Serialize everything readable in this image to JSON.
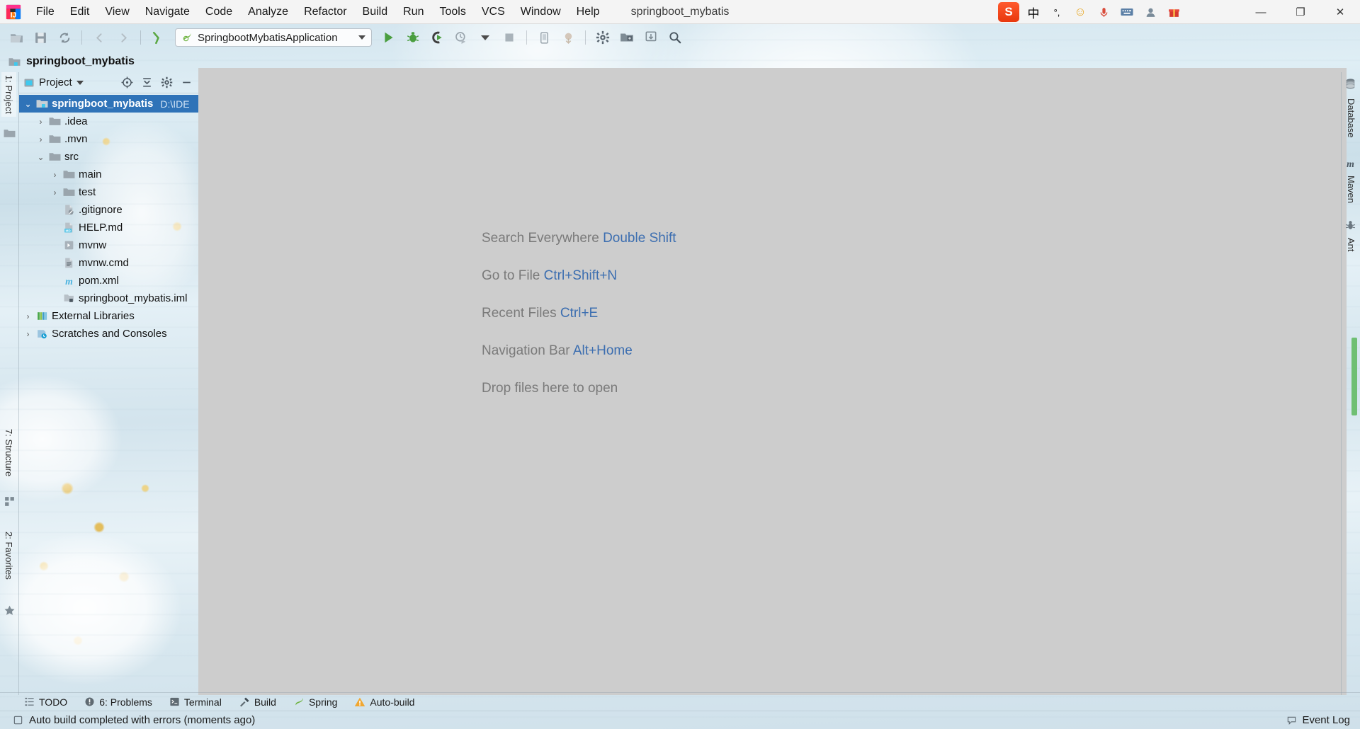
{
  "window": {
    "title": "springboot_mybatis",
    "app_icon": "intellij-idea-logo"
  },
  "menubar": {
    "items": [
      {
        "label": "File",
        "mnemonic": "F"
      },
      {
        "label": "Edit",
        "mnemonic": "E"
      },
      {
        "label": "View",
        "mnemonic": "V"
      },
      {
        "label": "Navigate",
        "mnemonic": "N"
      },
      {
        "label": "Code",
        "mnemonic": "C"
      },
      {
        "label": "Analyze",
        "mnemonic": "z"
      },
      {
        "label": "Refactor",
        "mnemonic": "R"
      },
      {
        "label": "Build",
        "mnemonic": "B"
      },
      {
        "label": "Run",
        "mnemonic": "u"
      },
      {
        "label": "Tools",
        "mnemonic": "T"
      },
      {
        "label": "VCS",
        "mnemonic": "S"
      },
      {
        "label": "Window",
        "mnemonic": "W"
      },
      {
        "label": "Help",
        "mnemonic": "H"
      }
    ]
  },
  "tray": {
    "items": [
      {
        "name": "sogou-ime-logo",
        "glyph": "S"
      },
      {
        "name": "chinese-input-mode",
        "glyph": "中"
      },
      {
        "name": "punctuation-mode",
        "glyph": "°,"
      },
      {
        "name": "emoji-icon",
        "glyph": "☺"
      },
      {
        "name": "microphone-icon",
        "glyph": "🎤"
      },
      {
        "name": "keyboard-icon",
        "glyph": "⌨"
      },
      {
        "name": "user-icon",
        "glyph": "👤"
      },
      {
        "name": "gift-icon",
        "glyph": "🎁"
      }
    ]
  },
  "window_controls": {
    "minimize": "—",
    "maximize": "❐",
    "close": "✕"
  },
  "toolbar": {
    "buttons": [
      {
        "name": "open-project-icon",
        "title": "Open"
      },
      {
        "name": "save-all-icon",
        "title": "Save All"
      },
      {
        "name": "sync-icon",
        "title": "Synchronize"
      },
      {
        "name": "back-icon",
        "title": "Back"
      },
      {
        "name": "forward-icon",
        "title": "Forward"
      },
      {
        "name": "compile-icon",
        "title": "Build Project"
      }
    ],
    "run_config": {
      "label": "SpringbootMybatisApplication",
      "icon": "spring-leaf-icon"
    },
    "run_buttons": [
      {
        "name": "run-icon",
        "title": "Run"
      },
      {
        "name": "debug-icon",
        "title": "Debug"
      },
      {
        "name": "run-with-coverage-icon",
        "title": "Run with Coverage"
      },
      {
        "name": "profile-icon",
        "title": "Profiler"
      },
      {
        "name": "stop-icon",
        "title": "Stop"
      }
    ],
    "right_buttons": [
      {
        "name": "device-manager-icon",
        "title": "Device Manager"
      },
      {
        "name": "sdk-manager-icon",
        "title": "SDK Manager"
      },
      {
        "name": "settings-gear-icon",
        "title": "Settings"
      },
      {
        "name": "project-structure-icon",
        "title": "Project Structure"
      },
      {
        "name": "update-project-icon",
        "title": "Update Project"
      },
      {
        "name": "search-everywhere-icon",
        "title": "Search Everywhere"
      }
    ]
  },
  "project_header": {
    "name": "springboot_mybatis",
    "icon": "module-folder-icon"
  },
  "left_strip": {
    "tabs": [
      {
        "label": "1: Project",
        "mnemonic": "1",
        "active": true
      },
      {
        "label": "7: Structure",
        "mnemonic": "7",
        "active": false
      },
      {
        "label": "2: Favorites",
        "mnemonic": "2",
        "active": false
      }
    ],
    "icons": [
      "project-folder-icon",
      "structure-blocks-icon",
      "favorites-star-icon"
    ]
  },
  "project_window": {
    "title": "Project",
    "actions": [
      {
        "name": "scroll-from-source-icon",
        "title": "Select Opened File"
      },
      {
        "name": "collapse-all-icon",
        "title": "Collapse All"
      },
      {
        "name": "settings-gear-icon",
        "title": "Show Options Menu"
      },
      {
        "name": "hide-icon",
        "title": "Hide"
      }
    ],
    "tree": [
      {
        "label": "springboot_mybatis",
        "path": "D:\\IDE",
        "icon": "module-folder-icon",
        "depth": 0,
        "arrow": "expanded",
        "selected": true
      },
      {
        "label": ".idea",
        "icon": "folder-icon",
        "depth": 1,
        "arrow": "collapsed",
        "selected": false
      },
      {
        "label": ".mvn",
        "icon": "folder-icon",
        "depth": 1,
        "arrow": "collapsed",
        "selected": false
      },
      {
        "label": "src",
        "icon": "folder-icon",
        "depth": 1,
        "arrow": "expanded",
        "selected": false
      },
      {
        "label": "main",
        "icon": "folder-icon",
        "depth": 2,
        "arrow": "collapsed",
        "selected": false
      },
      {
        "label": "test",
        "icon": "folder-icon",
        "depth": 2,
        "arrow": "collapsed",
        "selected": false
      },
      {
        "label": ".gitignore",
        "icon": "gitignore-file-icon",
        "depth": 2,
        "arrow": "none",
        "selected": false
      },
      {
        "label": "HELP.md",
        "icon": "markdown-file-icon",
        "depth": 2,
        "arrow": "none",
        "selected": false
      },
      {
        "label": "mvnw",
        "icon": "script-file-icon",
        "depth": 2,
        "arrow": "none",
        "selected": false
      },
      {
        "label": "mvnw.cmd",
        "icon": "text-file-icon",
        "depth": 2,
        "arrow": "none",
        "selected": false
      },
      {
        "label": "pom.xml",
        "icon": "maven-pom-icon",
        "depth": 2,
        "arrow": "none",
        "selected": false
      },
      {
        "label": "springboot_mybatis.iml",
        "icon": "iml-file-icon",
        "depth": 2,
        "arrow": "none",
        "selected": false
      },
      {
        "label": "External Libraries",
        "icon": "libraries-icon",
        "depth": 0,
        "arrow": "collapsed",
        "selected": false
      },
      {
        "label": "Scratches and Consoles",
        "icon": "scratches-icon",
        "depth": 0,
        "arrow": "collapsed",
        "selected": false
      }
    ]
  },
  "editor": {
    "background_color": "#cdcdcd",
    "hints": [
      {
        "text": "Search Everywhere",
        "key": "Double Shift"
      },
      {
        "text": "Go to File",
        "key": "Ctrl+Shift+N"
      },
      {
        "text": "Recent Files",
        "key": "Ctrl+E"
      },
      {
        "text": "Navigation Bar",
        "key": "Alt+Home"
      },
      {
        "text": "Drop files here to open",
        "key": ""
      }
    ]
  },
  "right_strip": {
    "tabs": [
      {
        "label": "Database",
        "icon": "database-icon"
      },
      {
        "label": "Maven",
        "icon": "maven-m-icon"
      },
      {
        "label": "Ant",
        "icon": "ant-bug-icon"
      }
    ]
  },
  "bottom_bar": {
    "items": [
      {
        "label": "TODO",
        "icon": "todo-list-icon",
        "mnemonic": ""
      },
      {
        "label": "6: Problems",
        "icon": "problems-icon",
        "mnemonic": "6"
      },
      {
        "label": "Terminal",
        "icon": "terminal-icon",
        "mnemonic": ""
      },
      {
        "label": "Build",
        "icon": "build-hammer-icon",
        "mnemonic": ""
      },
      {
        "label": "Spring",
        "icon": "spring-leaf-icon",
        "mnemonic": ""
      },
      {
        "label": "Auto-build",
        "icon": "warning-triangle-icon",
        "mnemonic": ""
      }
    ]
  },
  "status_bar": {
    "message": "Auto build completed with errors (moments ago)",
    "message_icon": "notification-icon",
    "event_log": "Event Log",
    "event_log_icon": "event-log-icon"
  },
  "colors": {
    "selection_blue": "#2f73b8",
    "link_blue": "#3c6eb0",
    "editor_gray": "#cdcdcd",
    "run_green": "#4a9e3f",
    "warning_orange": "#f0a732",
    "maven_blue": "#4ab3e0"
  }
}
